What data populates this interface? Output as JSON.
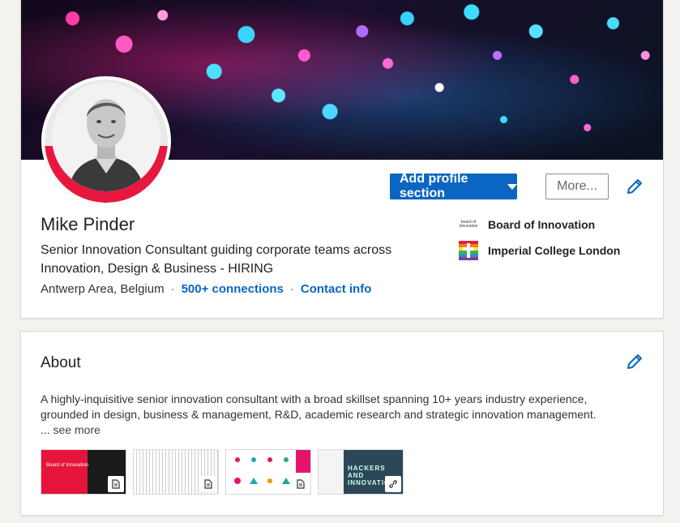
{
  "profile": {
    "name": "Mike Pinder",
    "headline": "Senior Innovation Consultant guiding corporate teams across Innovation, Design & Business - HIRING",
    "location": "Antwerp Area, Belgium",
    "connections": "500+ connections",
    "contact_info": "Contact info",
    "separator": "·"
  },
  "actions": {
    "add_section_label": "Add profile section",
    "more_label": "More..."
  },
  "orgs": [
    {
      "name": "Board of Innovation",
      "logo_text": "board of innovation",
      "icon": "board-of-innovation-logo"
    },
    {
      "name": "Imperial College London",
      "icon": "imperial-college-logo"
    }
  ],
  "about": {
    "title": "About",
    "text": "A highly-inquisitive senior innovation consultant with a broad skillset spanning 10+ years industry experience, grounded in design, business & management, R&D, academic research and strategic innovation management.",
    "see_more": "... see more",
    "media": [
      {
        "type": "document",
        "icon": "document-icon",
        "thumb_text": "Board of Innovation"
      },
      {
        "type": "document",
        "icon": "document-icon"
      },
      {
        "type": "document",
        "icon": "document-icon"
      },
      {
        "type": "link",
        "icon": "link-icon",
        "thumb_text": "HACKERS AND INNOVATION"
      }
    ]
  },
  "colors": {
    "primary": "#0a66c2",
    "avatar_ring": "#e8173f"
  }
}
